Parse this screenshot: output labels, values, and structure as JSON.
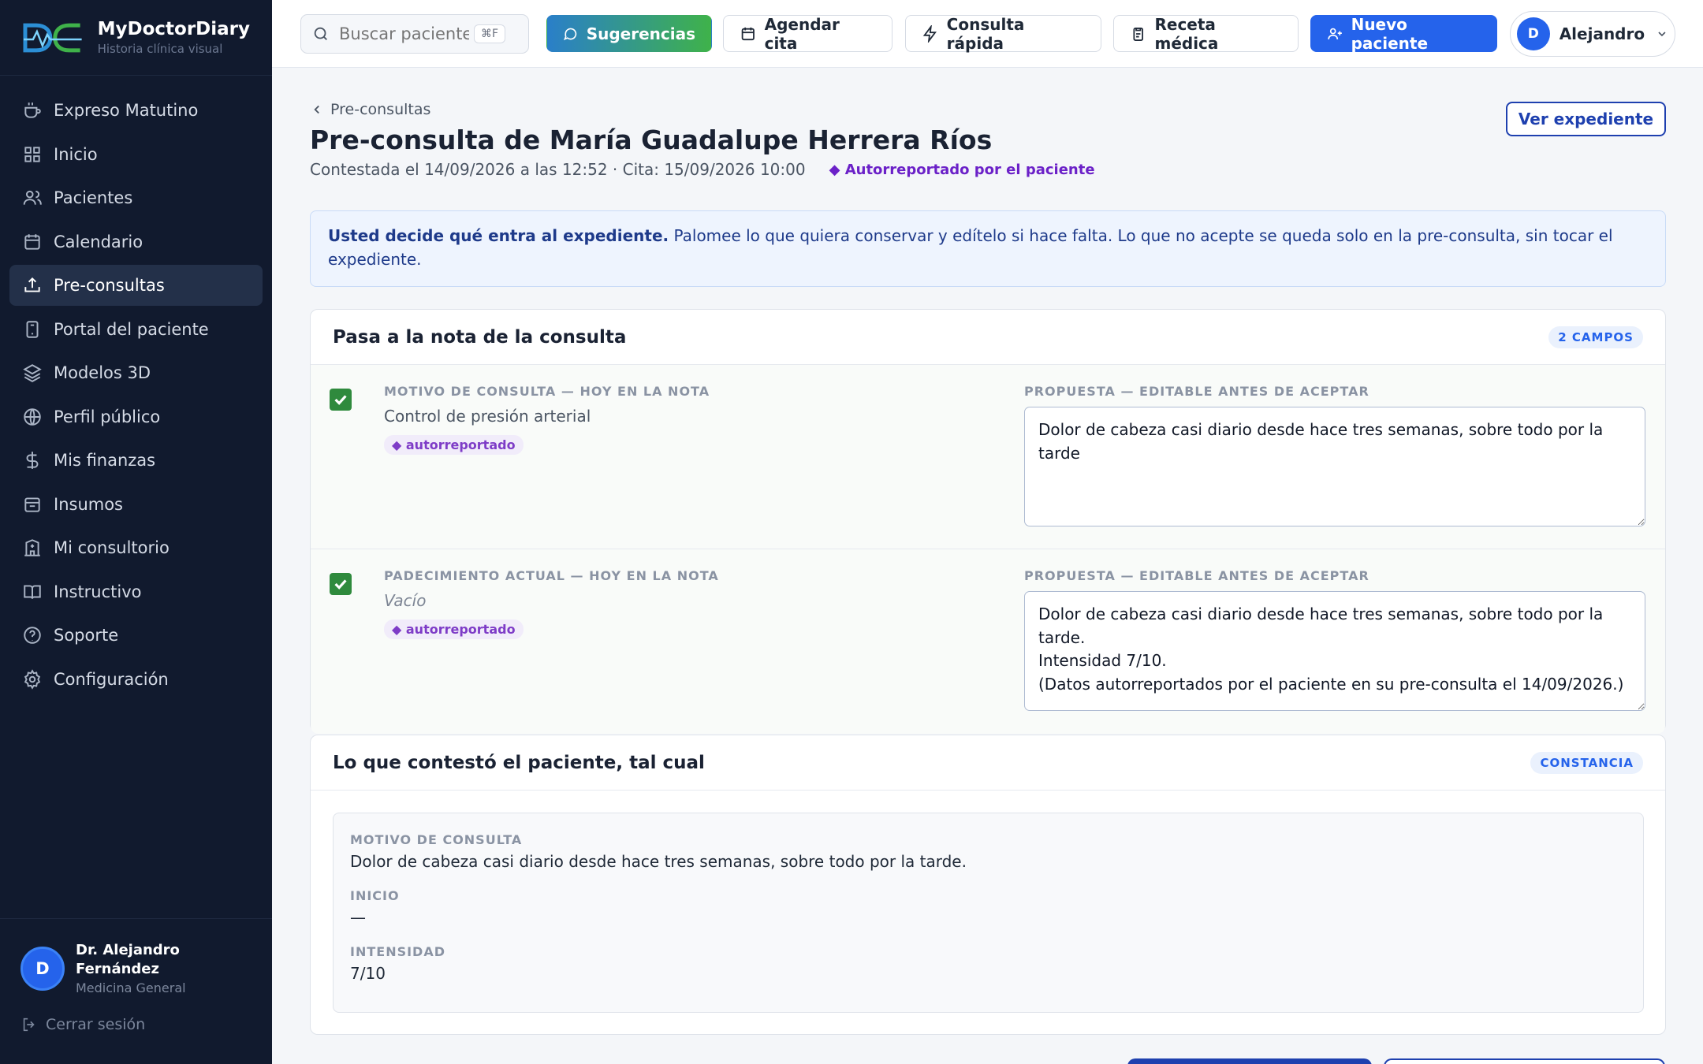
{
  "brand": {
    "name": "MyDoctorDiary",
    "subtitle": "Historia clínica visual"
  },
  "sidebar": {
    "items": [
      {
        "label": "Expreso Matutino",
        "icon": "coffee-icon"
      },
      {
        "label": "Inicio",
        "icon": "grid-icon"
      },
      {
        "label": "Pacientes",
        "icon": "users-icon"
      },
      {
        "label": "Calendario",
        "icon": "calendar-icon"
      },
      {
        "label": "Pre-consultas",
        "icon": "inbox-upload-icon",
        "active": true
      },
      {
        "label": "Portal del paciente",
        "icon": "tablet-icon"
      },
      {
        "label": "Modelos 3D",
        "icon": "layers-icon"
      },
      {
        "label": "Perfil público",
        "icon": "globe-icon"
      },
      {
        "label": "Mis finanzas",
        "icon": "dollar-icon"
      },
      {
        "label": "Insumos",
        "icon": "box-icon"
      },
      {
        "label": "Mi consultorio",
        "icon": "building-icon"
      },
      {
        "label": "Instructivo",
        "icon": "book-icon"
      },
      {
        "label": "Soporte",
        "icon": "help-icon"
      },
      {
        "label": "Configuración",
        "icon": "gear-icon"
      }
    ],
    "user": {
      "initial": "D",
      "name": "Dr. Alejandro Fernández",
      "role": "Medicina General"
    },
    "logout": "Cerrar sesión"
  },
  "topbar": {
    "search_placeholder": "Buscar paciente",
    "search_shortcut": "⌘F",
    "sugerencias": "Sugerencias",
    "agendar": "Agendar cita",
    "consulta": "Consulta rápida",
    "receta": "Receta médica",
    "nuevo": "Nuevo paciente",
    "user_initial": "D",
    "user_name": "Alejandro"
  },
  "page": {
    "breadcrumb": "Pre-consultas",
    "title": "Pre-consulta de María Guadalupe Herrera Ríos",
    "meta": "Contestada el 14/09/2026 a las 12:52 · Cita: 15/09/2026 10:00",
    "self_badge": "◆ Autorreportado por el paciente",
    "ver_expediente": "Ver expediente",
    "info_bold": "Usted decide qué entra al expediente.",
    "info_text": "Palomee lo que quiera conservar y edítelo si hace falta. Lo que no acepte se queda solo en la pre-consulta, sin tocar el expediente."
  },
  "nota": {
    "title": "Pasa a la nota de la consulta",
    "count": "2 CAMPOS",
    "proposal_label": "PROPUESTA — EDITABLE ANTES DE ACEPTAR",
    "tag": "◆ autorreportado",
    "rows": [
      {
        "label": "MOTIVO DE CONSULTA — HOY EN LA NOTA",
        "current": "Control de presión arterial",
        "checked": true,
        "proposal": "Dolor de cabeza casi diario desde hace tres semanas, sobre todo por la tarde"
      },
      {
        "label": "PADECIMIENTO ACTUAL — HOY EN LA NOTA",
        "current": "Vacío",
        "checked": true,
        "proposal": "Dolor de cabeza casi diario desde hace tres semanas, sobre todo por la tarde.\nIntensidad 7/10.\n(Datos autorreportados por el paciente en su pre-consulta el 14/09/2026.)"
      }
    ]
  },
  "constancia": {
    "title": "Lo que contestó el paciente, tal cual",
    "badge": "CONSTANCIA",
    "items": [
      {
        "label": "MOTIVO DE CONSULTA",
        "value": "Dolor de cabeza casi diario desde hace tres semanas, sobre todo por la tarde."
      },
      {
        "label": "INICIO",
        "value": "—"
      },
      {
        "label": "INTENSIDAD",
        "value": "7/10"
      }
    ]
  },
  "colors": {
    "sidebar_bg": "#111a2e",
    "primary": "#2563eb",
    "check": "#2f8a3d",
    "self_report": "#6b21c8"
  }
}
